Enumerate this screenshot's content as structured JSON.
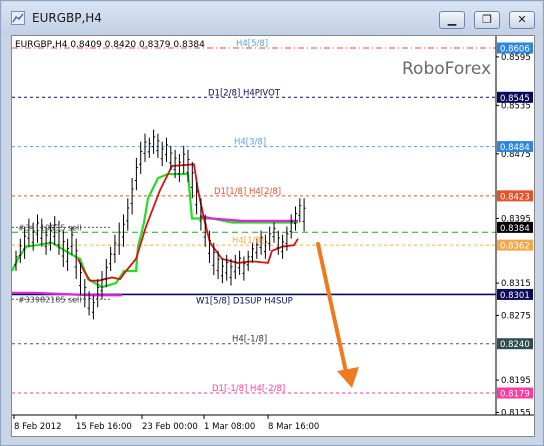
{
  "window": {
    "title": "EURGBP,H4",
    "buttons": [
      "minimize",
      "restore",
      "close"
    ]
  },
  "chart_header": "EURGBP,H4  0.8409 0.8420 0.8379 0.8384",
  "watermark": "RoboForex",
  "price_axis": {
    "ticks": [
      "0.8595",
      "0.8535",
      "0.8475",
      "0.8395",
      "0.8315",
      "0.8275",
      "0.8195",
      "0.8155"
    ],
    "boxes": [
      {
        "value": "0.8606",
        "color": "#2e86de",
        "text_color": "#ffffff",
        "price": 0.8606
      },
      {
        "value": "0.8545",
        "color": "#0a0a5a",
        "text_color": "#ffffff",
        "price": 0.8545
      },
      {
        "value": "0.8484",
        "color": "#2e86de",
        "text_color": "#ffffff",
        "price": 0.8484
      },
      {
        "value": "0.8423",
        "color": "#e8502a",
        "text_color": "#ffffff",
        "price": 0.8423
      },
      {
        "value": "0.8384",
        "color": "#000000",
        "text_color": "#ffffff",
        "price": 0.8384
      },
      {
        "value": "0.8362",
        "color": "#f5a84a",
        "text_color": "#ffffff",
        "price": 0.8362
      },
      {
        "value": "0.8301",
        "color": "#0a0a5a",
        "text_color": "#ffffff",
        "price": 0.8301
      },
      {
        "value": "0.8240",
        "color": "#2f4f4f",
        "text_color": "#ffffff",
        "price": 0.824
      },
      {
        "value": "0.8179",
        "color": "#ff3aa0",
        "text_color": "#ffffff",
        "price": 0.8179
      }
    ]
  },
  "time_axis": [
    "8 Feb 2012",
    "15 Feb 16:00",
    "23 Feb 00:00",
    "1 Mar 08:00",
    "8 Mar 16:00"
  ],
  "levels": [
    {
      "label": "H4[5/8]",
      "price": 0.8606,
      "color": "#e8502a",
      "style": "dashdot",
      "label_color": "#5aa0e6"
    },
    {
      "label": "D1[2/8] H4PIVOT",
      "price": 0.8545,
      "color": "#0a0a5a",
      "style": "dashed",
      "label_color": "#0a0a5a"
    },
    {
      "label": "H4[3/8]",
      "price": 0.8484,
      "color": "#5aa0e6",
      "style": "dashed",
      "label_color": "#5aa0e6"
    },
    {
      "label": "D1[1/8] H4[2/8]",
      "price": 0.8423,
      "color": "#e8502a",
      "style": "dashed",
      "label_color": "#e8502a"
    },
    {
      "label": "H4[1/8]",
      "price": 0.8362,
      "color": "#f5a84a",
      "style": "dashed",
      "label_color": "#f5a84a"
    },
    {
      "label": "W1[5/8] D1SUP H4SUP",
      "price": 0.8301,
      "color": "#0a0a5a",
      "style": "solid",
      "label_color": "#0a0a5a"
    },
    {
      "label": "H4[-1/8]",
      "price": 0.824,
      "color": "#555555",
      "style": "dashed",
      "label_color": "#333333"
    },
    {
      "label": "D1[-1/8] H4[-2/8]",
      "price": 0.8179,
      "color": "#ff3aa0",
      "style": "dashed",
      "label_color": "#ff3aa0"
    }
  ],
  "orders": [
    {
      "label": "#34119935 sell",
      "price": 0.8384
    },
    {
      "label": "#33982185 sell",
      "price": 0.8295
    }
  ],
  "colors": {
    "green_line": "#22dd22",
    "red_line": "#dd1111",
    "magenta_line": "#dd22dd",
    "dash_green": "#22aa22",
    "arrow": "#f07a20",
    "candle": "#000000"
  }
}
